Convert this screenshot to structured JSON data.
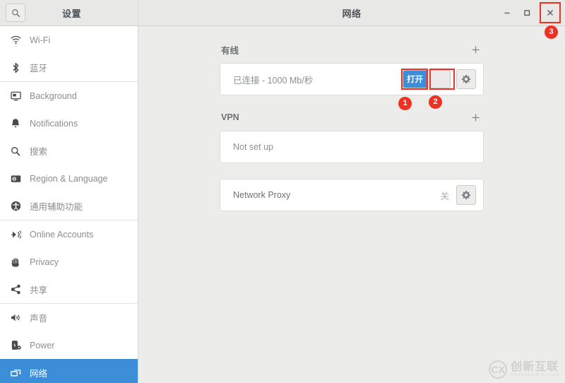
{
  "window": {
    "sidebar_title": "设置",
    "content_title": "网络",
    "search_icon": "search-icon",
    "minimize_label": "–",
    "maximize_label": "□",
    "close_label": "×"
  },
  "sidebar": {
    "items": [
      {
        "label": "Wi-Fi",
        "icon": "wifi-icon",
        "selected": false
      },
      {
        "label": "蓝牙",
        "icon": "bluetooth-icon",
        "selected": false
      },
      {
        "label": "Background",
        "icon": "background-icon",
        "selected": false
      },
      {
        "label": "Notifications",
        "icon": "bell-icon",
        "selected": false
      },
      {
        "label": "搜索",
        "icon": "search-icon",
        "selected": false
      },
      {
        "label": "Region & Language",
        "icon": "region-language-icon",
        "selected": false
      },
      {
        "label": "通用辅助功能",
        "icon": "accessibility-icon",
        "selected": false
      },
      {
        "label": "Online Accounts",
        "icon": "online-accounts-icon",
        "selected": false
      },
      {
        "label": "Privacy",
        "icon": "privacy-icon",
        "selected": false
      },
      {
        "label": "共享",
        "icon": "share-icon",
        "selected": false
      },
      {
        "label": "声音",
        "icon": "sound-icon",
        "selected": false
      },
      {
        "label": "Power",
        "icon": "power-icon",
        "selected": false
      },
      {
        "label": "网络",
        "icon": "network-icon",
        "selected": true
      }
    ]
  },
  "main": {
    "wired": {
      "section_title": "有线",
      "add_label": "+",
      "status_text": "已连接 - 1000 Mb/秒",
      "toggle_on_label": "打开",
      "settings_icon": "gear-icon"
    },
    "vpn": {
      "section_title": "VPN",
      "add_label": "+",
      "status_text": "Not set up"
    },
    "proxy": {
      "label": "Network Proxy",
      "status_text": "关",
      "settings_icon": "gear-icon"
    }
  },
  "annotations": {
    "badges": [
      {
        "id": "1",
        "text": "1"
      },
      {
        "id": "2",
        "text": "2"
      },
      {
        "id": "3",
        "text": "3"
      }
    ],
    "highlight_color": "#ef3124"
  },
  "watermark": {
    "mark": "CX",
    "name_cn": "创新互联",
    "name_en": "CHUANGXIN HULIAN"
  }
}
